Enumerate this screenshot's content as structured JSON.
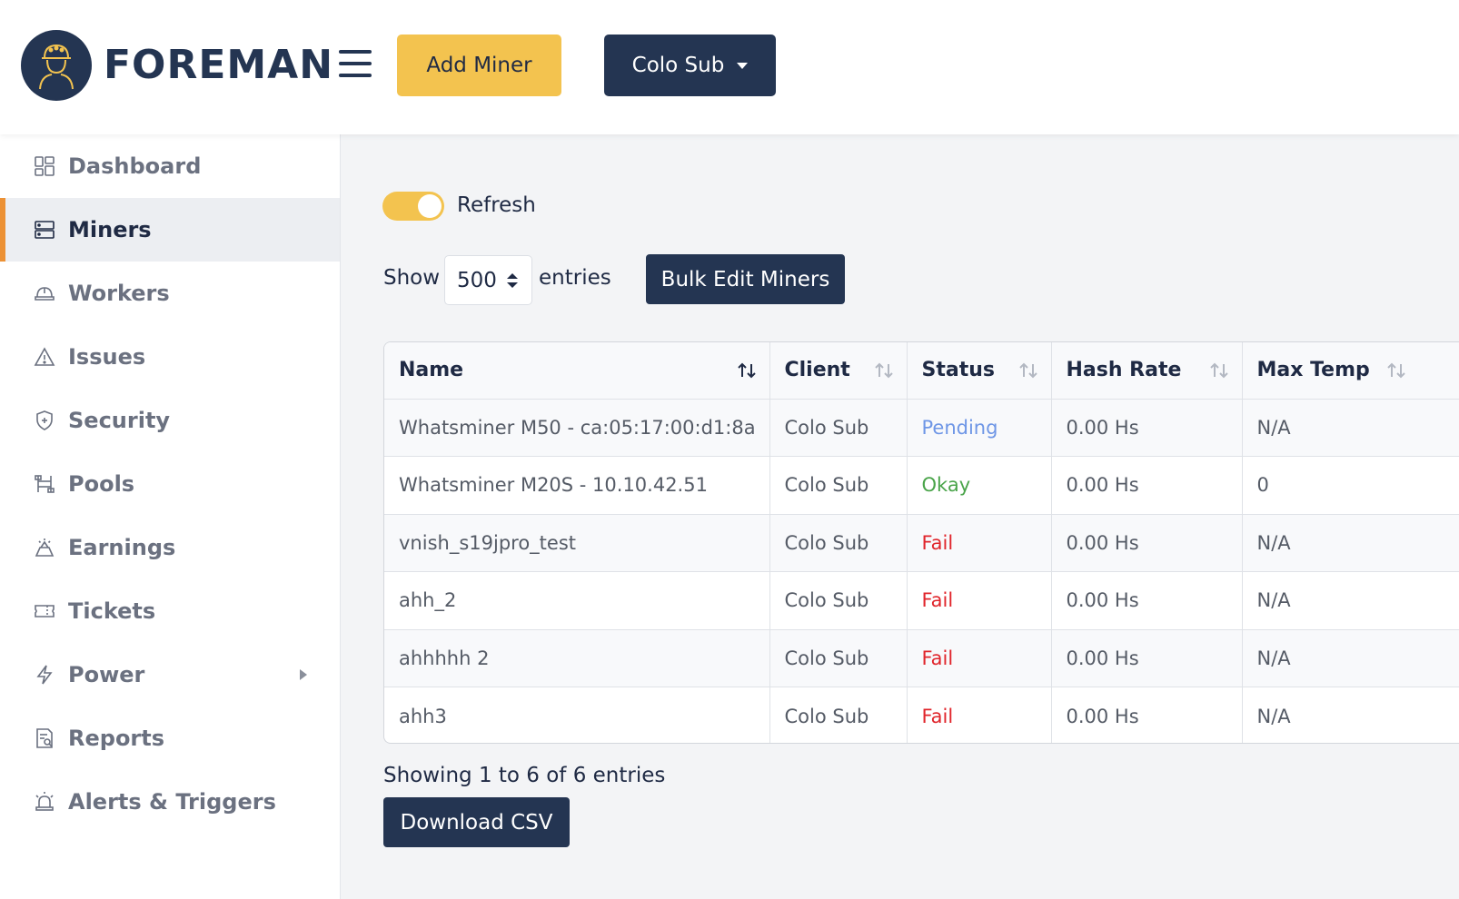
{
  "header": {
    "logo_text": "FOREMAN",
    "add_miner_label": "Add Miner",
    "client_selector_label": "Colo Sub"
  },
  "sidebar": {
    "items": [
      {
        "label": "Dashboard",
        "icon": "dashboard-icon"
      },
      {
        "label": "Miners",
        "icon": "server-icon",
        "active": true
      },
      {
        "label": "Workers",
        "icon": "hard-hat-icon"
      },
      {
        "label": "Issues",
        "icon": "warning-icon"
      },
      {
        "label": "Security",
        "icon": "shield-icon"
      },
      {
        "label": "Pools",
        "icon": "pools-icon"
      },
      {
        "label": "Earnings",
        "icon": "earnings-icon"
      },
      {
        "label": "Tickets",
        "icon": "ticket-icon"
      },
      {
        "label": "Power",
        "icon": "lightning-icon",
        "has_submenu": true
      },
      {
        "label": "Reports",
        "icon": "report-icon"
      },
      {
        "label": "Alerts & Triggers",
        "icon": "alarm-icon"
      }
    ]
  },
  "main": {
    "refresh_label": "Refresh",
    "refresh_on": true,
    "show_label": "Show",
    "entries_value": "500",
    "entries_label": "entries",
    "bulk_edit_label": "Bulk Edit Miners",
    "table": {
      "columns": [
        "Name",
        "Client",
        "Status",
        "Hash Rate",
        "Max Temp"
      ],
      "rows": [
        {
          "name": "Whatsminer M50 - ca:05:17:00:d1:8a",
          "client": "Colo Sub",
          "status": "Pending",
          "hash_rate": "0.00 Hs",
          "max_temp": "N/A"
        },
        {
          "name": "Whatsminer M20S - 10.10.42.51",
          "client": "Colo Sub",
          "status": "Okay",
          "hash_rate": "0.00 Hs",
          "max_temp": "0"
        },
        {
          "name": "vnish_s19jpro_test",
          "client": "Colo Sub",
          "status": "Fail",
          "hash_rate": "0.00 Hs",
          "max_temp": "N/A"
        },
        {
          "name": "ahh_2",
          "client": "Colo Sub",
          "status": "Fail",
          "hash_rate": "0.00 Hs",
          "max_temp": "N/A"
        },
        {
          "name": "ahhhhh 2",
          "client": "Colo Sub",
          "status": "Fail",
          "hash_rate": "0.00 Hs",
          "max_temp": "N/A"
        },
        {
          "name": "ahh3",
          "client": "Colo Sub",
          "status": "Fail",
          "hash_rate": "0.00 Hs",
          "max_temp": "N/A"
        }
      ]
    },
    "showing_text": "Showing 1 to 6 of 6 entries",
    "download_csv_label": "Download CSV"
  },
  "colors": {
    "brand_navy": "#243552",
    "accent_yellow": "#f3c34f",
    "active_marker_orange": "#ec9135",
    "status_pending": "#6e96e6",
    "status_okay": "#4aa44a",
    "status_fail": "#e0252b"
  }
}
